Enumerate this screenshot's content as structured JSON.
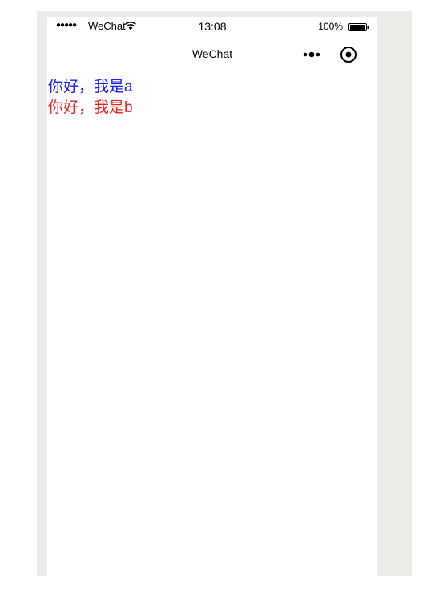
{
  "status_bar": {
    "signal": "●●●●●",
    "carrier": "WeChat",
    "time": "13:08",
    "battery": "100%"
  },
  "nav": {
    "title": "WeChat"
  },
  "content": {
    "line_a": "你好，我是a",
    "line_b": "你好，我是b"
  },
  "colors": {
    "line_a": "#1a20f0",
    "line_b": "#f02020",
    "canvas": "#ecebe8"
  },
  "icons": {
    "wifi": "wifi-icon",
    "battery": "battery-icon",
    "more": "more-dots-icon",
    "record": "record-circle-icon"
  }
}
